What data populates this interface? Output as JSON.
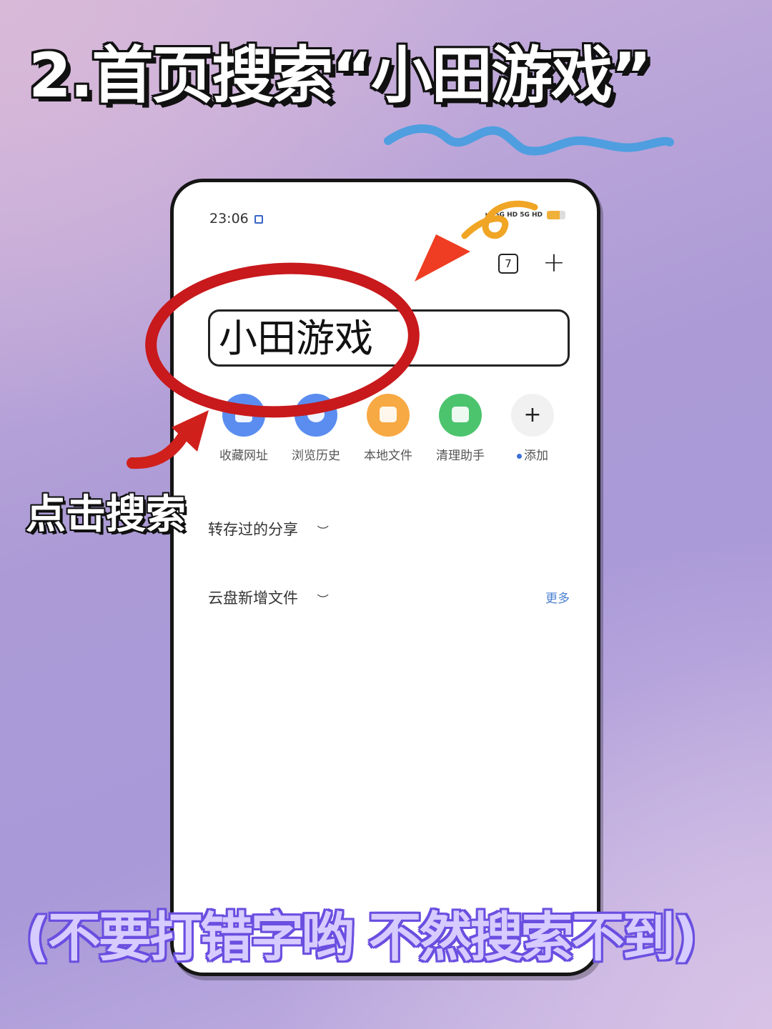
{
  "heading": "2.首页搜索“小田游戏”",
  "phone": {
    "status_time": "23:06",
    "status_network": "5G HD 5G HD",
    "tab_count": "7",
    "new_tab_glyph": "+",
    "search_value": "小田游戏",
    "quick_items": [
      {
        "label": "收藏网址",
        "icon": "bookmark-icon",
        "color": "#5b8df0"
      },
      {
        "label": "浏览历史",
        "icon": "history-icon",
        "color": "#5b8df0"
      },
      {
        "label": "本地文件",
        "icon": "folder-icon",
        "color": "#f7a943"
      },
      {
        "label": "清理助手",
        "icon": "cleaner-icon",
        "color": "#4cc46e"
      },
      {
        "label": "添加",
        "icon": "add-icon",
        "color": "#f1f1f1"
      }
    ],
    "add_glyph": "+",
    "sections": {
      "saved_shares": "转存过的分享",
      "cloud_new_files": "云盘新增文件",
      "more_label": "更多",
      "hide_glyph": "︶"
    }
  },
  "annotations": {
    "tap_label": "点击搜索",
    "footer_note": "(不要打错字哟  不然搜索不到)",
    "circle_color": "#c8191c",
    "arrow_color": "#e0231f",
    "squiggle_color": "#4f9ee0"
  }
}
